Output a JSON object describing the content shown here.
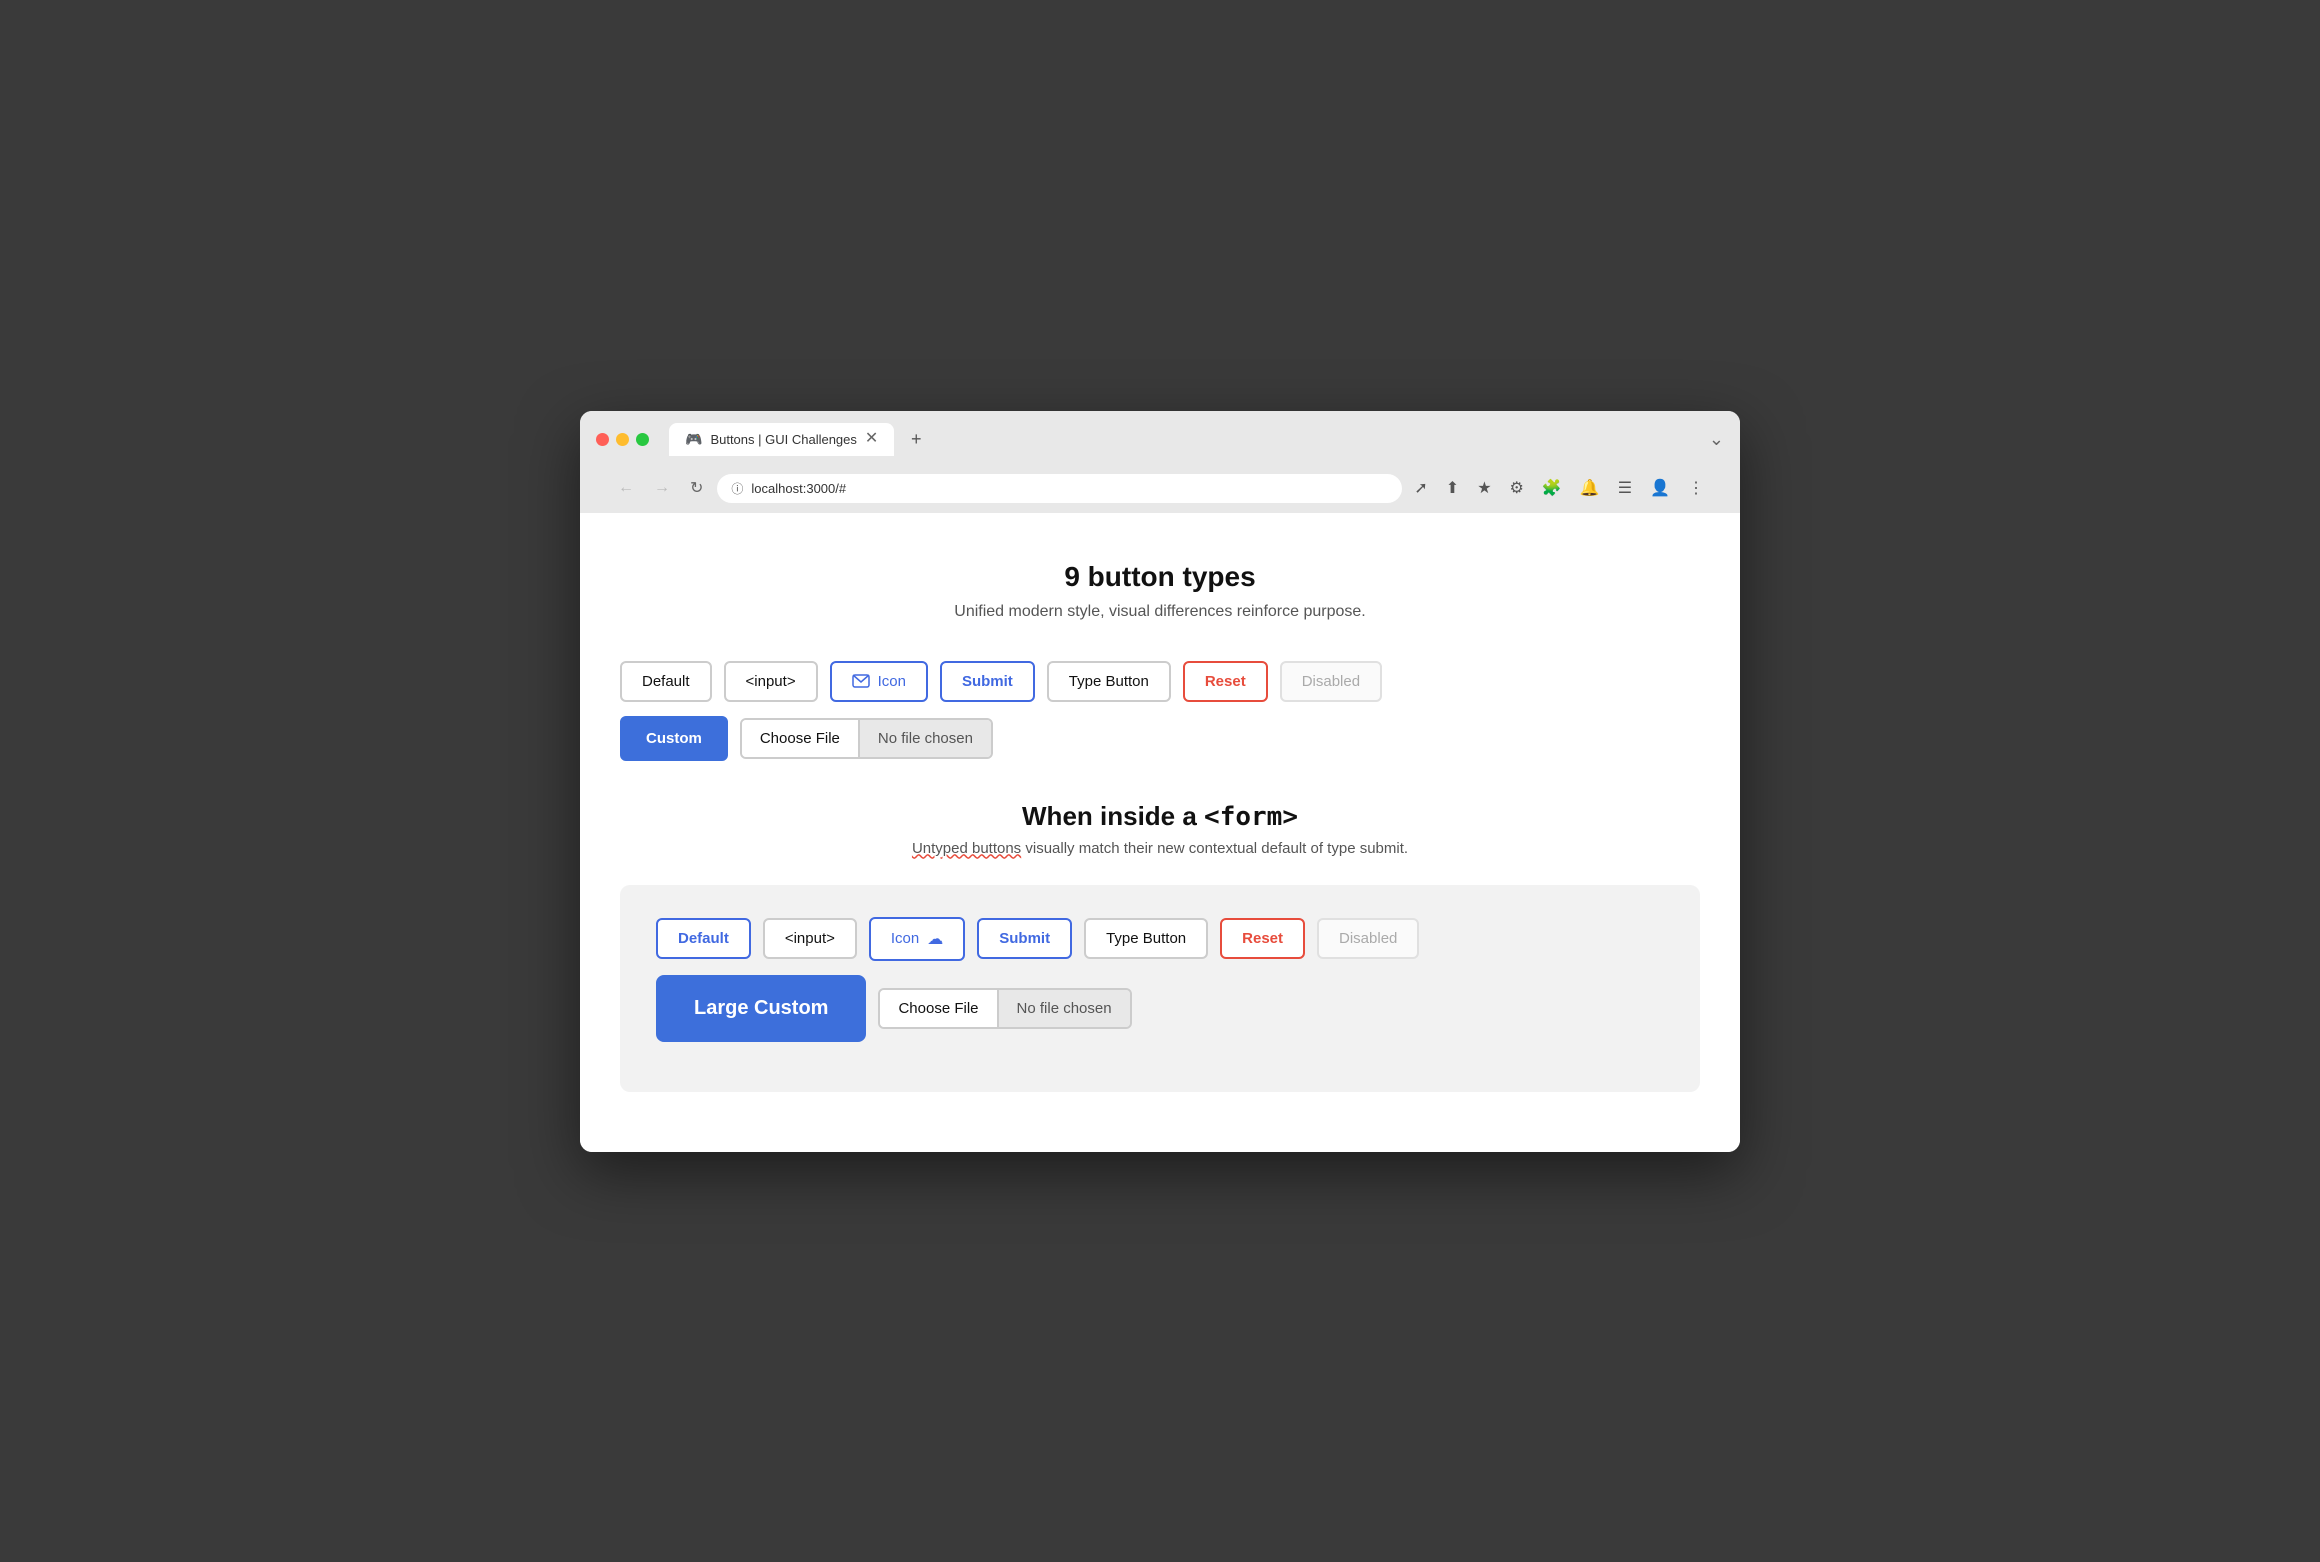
{
  "browser": {
    "tab_title": "Buttons | GUI Challenges",
    "tab_icon": "🎮",
    "address": "localhost:3000/#",
    "new_tab_label": "+",
    "chevron_down": "⌄"
  },
  "page": {
    "title": "9 button types",
    "subtitle": "Unified modern style, visual differences reinforce purpose.",
    "section2_title_prefix": "When inside a ",
    "section2_title_code": "<form>",
    "section2_subtitle_part1": "Untyped buttons",
    "section2_subtitle_part2": " visually match their new contextual default of type submit."
  },
  "buttons_row1": [
    {
      "label": "Default",
      "type": "default"
    },
    {
      "label": "<input>",
      "type": "input"
    },
    {
      "label": "Icon",
      "type": "icon"
    },
    {
      "label": "Submit",
      "type": "submit"
    },
    {
      "label": "Type Button",
      "type": "type-button"
    },
    {
      "label": "Reset",
      "type": "reset"
    },
    {
      "label": "Disabled",
      "type": "disabled"
    }
  ],
  "buttons_row2": {
    "custom_label": "Custom",
    "file_choose_label": "Choose File",
    "file_no_chosen_label": "No file chosen"
  },
  "form_row1": [
    {
      "label": "Default",
      "type": "default"
    },
    {
      "label": "<input>",
      "type": "input"
    },
    {
      "label": "Icon",
      "type": "icon"
    },
    {
      "label": "Submit",
      "type": "submit"
    },
    {
      "label": "Type Button",
      "type": "type-button"
    },
    {
      "label": "Reset",
      "type": "reset"
    },
    {
      "label": "Disabled",
      "type": "disabled"
    }
  ],
  "form_row2": {
    "custom_label": "Large Custom",
    "file_choose_label": "Choose File",
    "file_no_chosen_label": "No file chosen"
  }
}
